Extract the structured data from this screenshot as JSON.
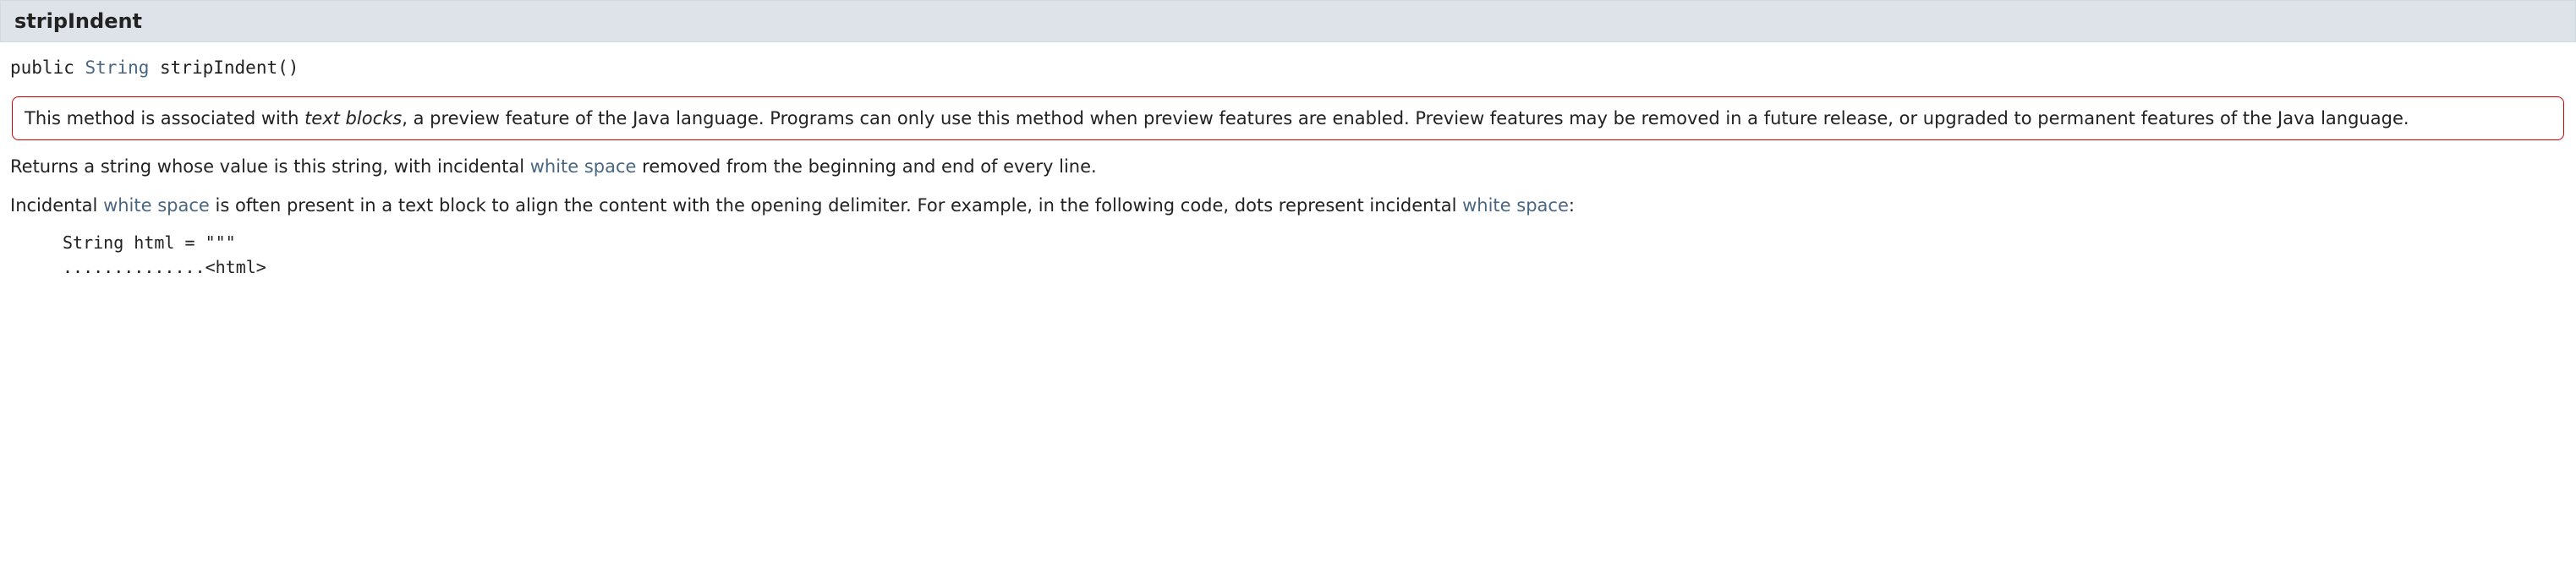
{
  "header": {
    "methodName": "stripIndent"
  },
  "signature": {
    "modifier": "public",
    "returnType": "String",
    "nameAndParams": "stripIndent()"
  },
  "previewNote": {
    "text_before_italic": "This method is associated with ",
    "italic": "text blocks",
    "text_after_italic": ", a preview feature of the Java language. Programs can only use this method when preview features are enabled. Preview features may be removed in a future release, or upgraded to permanent features of the Java language."
  },
  "para1": {
    "before": "Returns a string whose value is this string, with incidental ",
    "link": "white space",
    "after": " removed from the beginning and end of every line."
  },
  "para2": {
    "before1": "Incidental ",
    "link1": "white space",
    "mid": " is often present in a text block to align the content with the opening delimiter. For example, in the following code, dots represent incidental ",
    "link2": "white space",
    "after": ":"
  },
  "code": {
    "line1": "String html = \"\"\"",
    "line2": "..............<html>"
  }
}
